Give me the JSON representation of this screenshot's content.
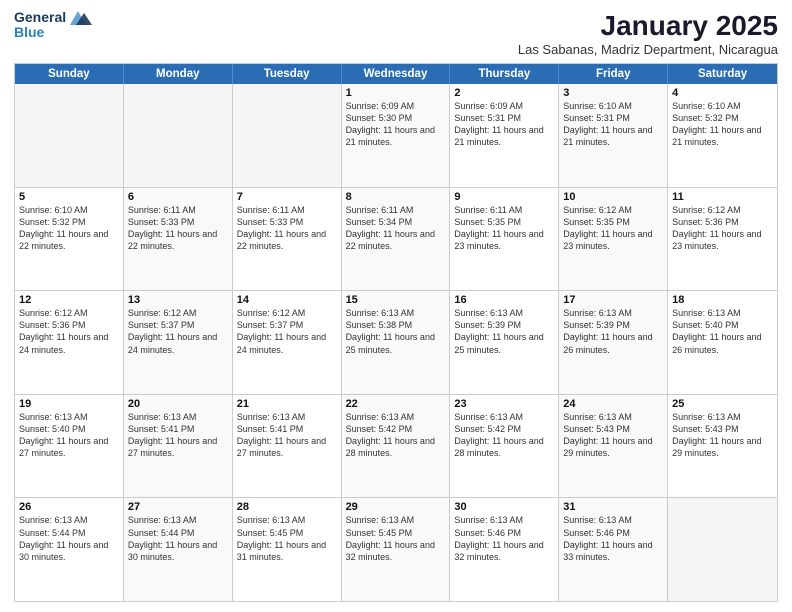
{
  "header": {
    "logo_general": "General",
    "logo_blue": "Blue",
    "month_title": "January 2025",
    "location": "Las Sabanas, Madriz Department, Nicaragua"
  },
  "weekdays": [
    "Sunday",
    "Monday",
    "Tuesday",
    "Wednesday",
    "Thursday",
    "Friday",
    "Saturday"
  ],
  "rows": [
    [
      {
        "day": "",
        "info": ""
      },
      {
        "day": "",
        "info": ""
      },
      {
        "day": "",
        "info": ""
      },
      {
        "day": "1",
        "info": "Sunrise: 6:09 AM\nSunset: 5:30 PM\nDaylight: 11 hours and 21 minutes."
      },
      {
        "day": "2",
        "info": "Sunrise: 6:09 AM\nSunset: 5:31 PM\nDaylight: 11 hours and 21 minutes."
      },
      {
        "day": "3",
        "info": "Sunrise: 6:10 AM\nSunset: 5:31 PM\nDaylight: 11 hours and 21 minutes."
      },
      {
        "day": "4",
        "info": "Sunrise: 6:10 AM\nSunset: 5:32 PM\nDaylight: 11 hours and 21 minutes."
      }
    ],
    [
      {
        "day": "5",
        "info": "Sunrise: 6:10 AM\nSunset: 5:32 PM\nDaylight: 11 hours and 22 minutes."
      },
      {
        "day": "6",
        "info": "Sunrise: 6:11 AM\nSunset: 5:33 PM\nDaylight: 11 hours and 22 minutes."
      },
      {
        "day": "7",
        "info": "Sunrise: 6:11 AM\nSunset: 5:33 PM\nDaylight: 11 hours and 22 minutes."
      },
      {
        "day": "8",
        "info": "Sunrise: 6:11 AM\nSunset: 5:34 PM\nDaylight: 11 hours and 22 minutes."
      },
      {
        "day": "9",
        "info": "Sunrise: 6:11 AM\nSunset: 5:35 PM\nDaylight: 11 hours and 23 minutes."
      },
      {
        "day": "10",
        "info": "Sunrise: 6:12 AM\nSunset: 5:35 PM\nDaylight: 11 hours and 23 minutes."
      },
      {
        "day": "11",
        "info": "Sunrise: 6:12 AM\nSunset: 5:36 PM\nDaylight: 11 hours and 23 minutes."
      }
    ],
    [
      {
        "day": "12",
        "info": "Sunrise: 6:12 AM\nSunset: 5:36 PM\nDaylight: 11 hours and 24 minutes."
      },
      {
        "day": "13",
        "info": "Sunrise: 6:12 AM\nSunset: 5:37 PM\nDaylight: 11 hours and 24 minutes."
      },
      {
        "day": "14",
        "info": "Sunrise: 6:12 AM\nSunset: 5:37 PM\nDaylight: 11 hours and 24 minutes."
      },
      {
        "day": "15",
        "info": "Sunrise: 6:13 AM\nSunset: 5:38 PM\nDaylight: 11 hours and 25 minutes."
      },
      {
        "day": "16",
        "info": "Sunrise: 6:13 AM\nSunset: 5:39 PM\nDaylight: 11 hours and 25 minutes."
      },
      {
        "day": "17",
        "info": "Sunrise: 6:13 AM\nSunset: 5:39 PM\nDaylight: 11 hours and 26 minutes."
      },
      {
        "day": "18",
        "info": "Sunrise: 6:13 AM\nSunset: 5:40 PM\nDaylight: 11 hours and 26 minutes."
      }
    ],
    [
      {
        "day": "19",
        "info": "Sunrise: 6:13 AM\nSunset: 5:40 PM\nDaylight: 11 hours and 27 minutes."
      },
      {
        "day": "20",
        "info": "Sunrise: 6:13 AM\nSunset: 5:41 PM\nDaylight: 11 hours and 27 minutes."
      },
      {
        "day": "21",
        "info": "Sunrise: 6:13 AM\nSunset: 5:41 PM\nDaylight: 11 hours and 27 minutes."
      },
      {
        "day": "22",
        "info": "Sunrise: 6:13 AM\nSunset: 5:42 PM\nDaylight: 11 hours and 28 minutes."
      },
      {
        "day": "23",
        "info": "Sunrise: 6:13 AM\nSunset: 5:42 PM\nDaylight: 11 hours and 28 minutes."
      },
      {
        "day": "24",
        "info": "Sunrise: 6:13 AM\nSunset: 5:43 PM\nDaylight: 11 hours and 29 minutes."
      },
      {
        "day": "25",
        "info": "Sunrise: 6:13 AM\nSunset: 5:43 PM\nDaylight: 11 hours and 29 minutes."
      }
    ],
    [
      {
        "day": "26",
        "info": "Sunrise: 6:13 AM\nSunset: 5:44 PM\nDaylight: 11 hours and 30 minutes."
      },
      {
        "day": "27",
        "info": "Sunrise: 6:13 AM\nSunset: 5:44 PM\nDaylight: 11 hours and 30 minutes."
      },
      {
        "day": "28",
        "info": "Sunrise: 6:13 AM\nSunset: 5:45 PM\nDaylight: 11 hours and 31 minutes."
      },
      {
        "day": "29",
        "info": "Sunrise: 6:13 AM\nSunset: 5:45 PM\nDaylight: 11 hours and 32 minutes."
      },
      {
        "day": "30",
        "info": "Sunrise: 6:13 AM\nSunset: 5:46 PM\nDaylight: 11 hours and 32 minutes."
      },
      {
        "day": "31",
        "info": "Sunrise: 6:13 AM\nSunset: 5:46 PM\nDaylight: 11 hours and 33 minutes."
      },
      {
        "day": "",
        "info": ""
      }
    ]
  ]
}
